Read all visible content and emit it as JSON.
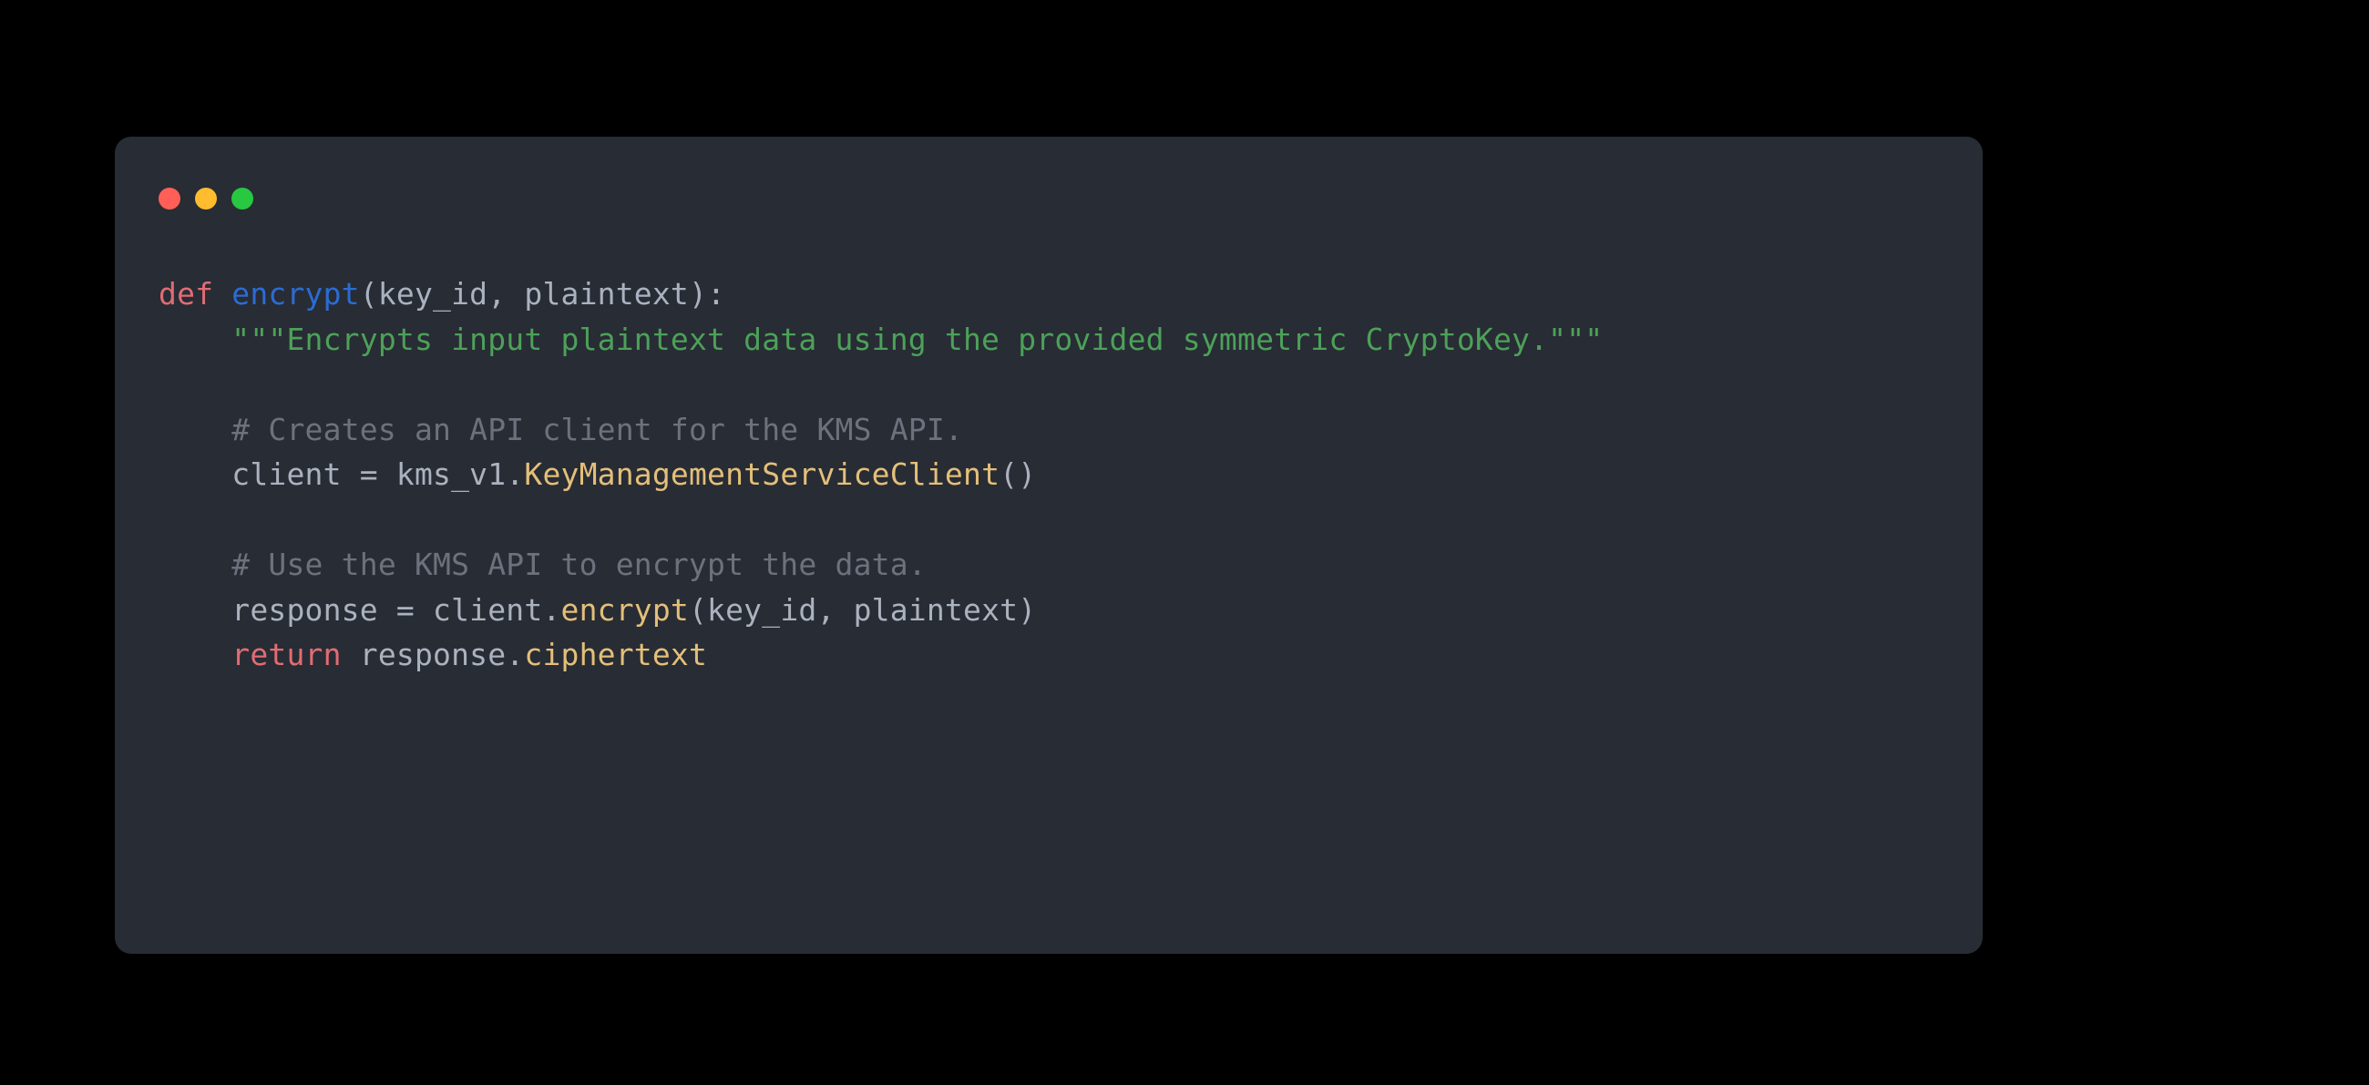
{
  "window": {
    "traffic_lights": {
      "close": "#ff5f57",
      "minimize": "#febc2e",
      "zoom": "#28c840"
    }
  },
  "code": {
    "line1": {
      "def": "def",
      "sp1": " ",
      "fn": "encrypt",
      "sig": "(key_id, plaintext):"
    },
    "line2": {
      "indent": "    ",
      "doc": "\"\"\"Encrypts input plaintext data using the provided symmetric CryptoKey.\"\"\""
    },
    "line3": "",
    "line4": {
      "indent": "    ",
      "comment": "# Creates an API client for the KMS API."
    },
    "line5": {
      "indent": "    ",
      "lhs": "client = kms_v1.",
      "call": "KeyManagementServiceClient",
      "tail": "()"
    },
    "line6": "",
    "line7": {
      "indent": "    ",
      "comment": "# Use the KMS API to encrypt the data."
    },
    "line8": {
      "indent": "    ",
      "lhs": "response = client.",
      "call": "encrypt",
      "tail": "(key_id, plaintext)"
    },
    "line9": {
      "indent": "    ",
      "ret": "return",
      "sp": " ",
      "obj": "response.",
      "attr": "ciphertext"
    }
  }
}
